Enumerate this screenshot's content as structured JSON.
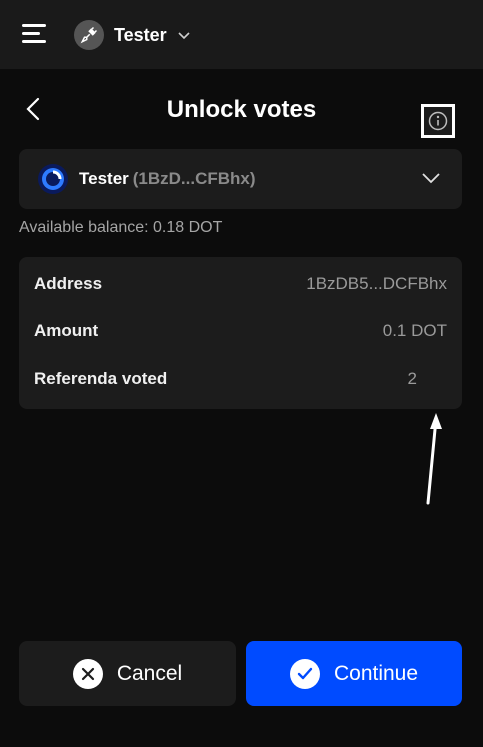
{
  "topbar": {
    "account_name": "Tester",
    "icons": [
      "menu-icon",
      "plug-icon",
      "chevron-down-icon"
    ]
  },
  "header": {
    "title": "Unlock votes",
    "back_icon": "chevron-left-icon"
  },
  "account_select": {
    "name": "Tester",
    "address_short": "(1BzD...CFBhx)",
    "icon": "polkadot-logo-icon",
    "chevron_icon": "chevron-down-icon"
  },
  "balance": {
    "text": "Available balance: 0.18 DOT"
  },
  "details": {
    "rows": [
      {
        "label": "Address",
        "value": "1BzDB5...DCFBhx"
      },
      {
        "label": "Amount",
        "value": "0.1 DOT"
      },
      {
        "label": "Referenda voted",
        "value": "2"
      }
    ],
    "info_icon": "info-circle-icon"
  },
  "buttons": {
    "cancel_label": "Cancel",
    "continue_label": "Continue"
  },
  "colors": {
    "background": "#0c0c0c",
    "card": "#1c1c1c",
    "accent": "#004bff",
    "muted_text": "#a5a5a5"
  }
}
